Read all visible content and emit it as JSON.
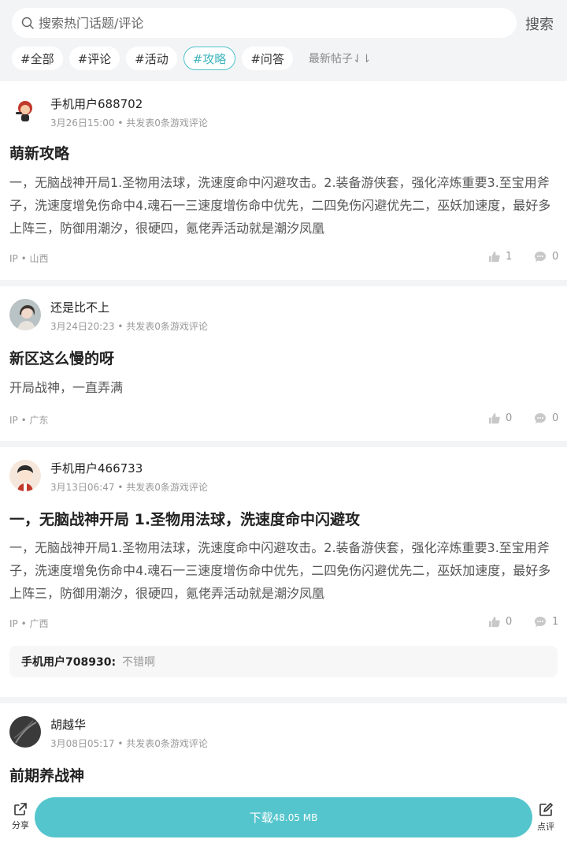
{
  "search": {
    "placeholder": "搜索热门话题/评论",
    "button_label": "搜索"
  },
  "tags": [
    {
      "label": "#全部",
      "active": false
    },
    {
      "label": "#评论",
      "active": false
    },
    {
      "label": "#活动",
      "active": false
    },
    {
      "label": "#攻略",
      "active": true
    },
    {
      "label": "#问答",
      "active": false
    }
  ],
  "sort_label": "最新帖子⇃⇂",
  "posts": [
    {
      "username": "手机用户688702",
      "date": "3月26日15:00",
      "stats_text": "• 共发表0条游戏评论",
      "title": "萌新攻略",
      "body": "一，无脑战神开局1.圣物用法球，洗速度命中闪避攻击。2.装备游侠套，强化淬炼重要3.至宝用斧子，洗速度增免伤命中4.魂石一三速度增伤命中优先，二四免伤闪避优先二，巫妖加速度，最好多上阵三，防御用潮汐，很硬四，氪佬弄活动就是潮汐凤凰",
      "ip": "IP • 山西",
      "likes": "1",
      "comments": "0"
    },
    {
      "username": "还是比不上",
      "date": "3月24日20:23",
      "stats_text": "• 共发表0条游戏评论",
      "title": "新区这么慢的呀",
      "body": "开局战神，一直弄满",
      "ip": "IP • 广东",
      "likes": "0",
      "comments": "0"
    },
    {
      "username": "手机用户466733",
      "date": "3月13日06:47",
      "stats_text": "• 共发表0条游戏评论",
      "title": "一，无脑战神开局 1.圣物用法球，洗速度命中闪避攻",
      "body": "一，无脑战神开局1.圣物用法球，洗速度命中闪避攻击。2.装备游侠套，强化淬炼重要3.至宝用斧子，洗速度增免伤命中4.魂石一三速度增伤命中优先，二四免伤闪避优先二，巫妖加速度，最好多上阵三，防御用潮汐，很硬四，氪佬弄活动就是潮汐凤凰",
      "ip": "IP • 广西",
      "likes": "0",
      "comments": "1",
      "reply": {
        "user": "手机用户708930:",
        "text": "不错啊"
      }
    },
    {
      "username": "胡越华",
      "date": "3月08日05:17",
      "stats_text": "• 共发表0条游戏评论",
      "title": "前期养战神"
    }
  ],
  "bottom": {
    "share_label": "分享",
    "download_label": "下载",
    "download_size": "48.05 MB",
    "review_label": "点评"
  },
  "colors": {
    "accent": "#55c5cd",
    "background": "#f3f4f6"
  }
}
